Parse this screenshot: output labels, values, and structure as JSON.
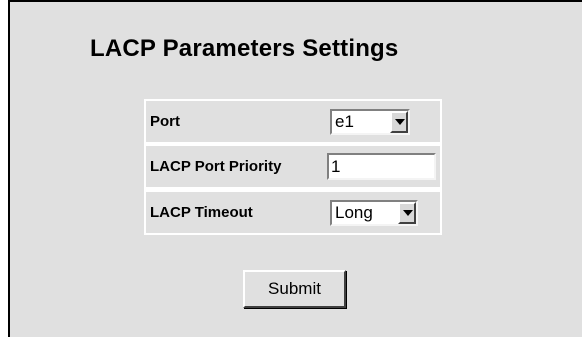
{
  "page": {
    "title": "LACP Parameters Settings"
  },
  "form": {
    "port": {
      "label": "Port",
      "value": "e1"
    },
    "priority": {
      "label": "LACP Port Priority",
      "value": "1"
    },
    "timeout": {
      "label": "LACP Timeout",
      "value": "Long"
    }
  },
  "actions": {
    "submit_label": "Submit"
  },
  "icons": {
    "dropdown": "chevron-down-icon"
  },
  "colors": {
    "background": "#e0e0e0",
    "table_background": "#ffffff"
  }
}
